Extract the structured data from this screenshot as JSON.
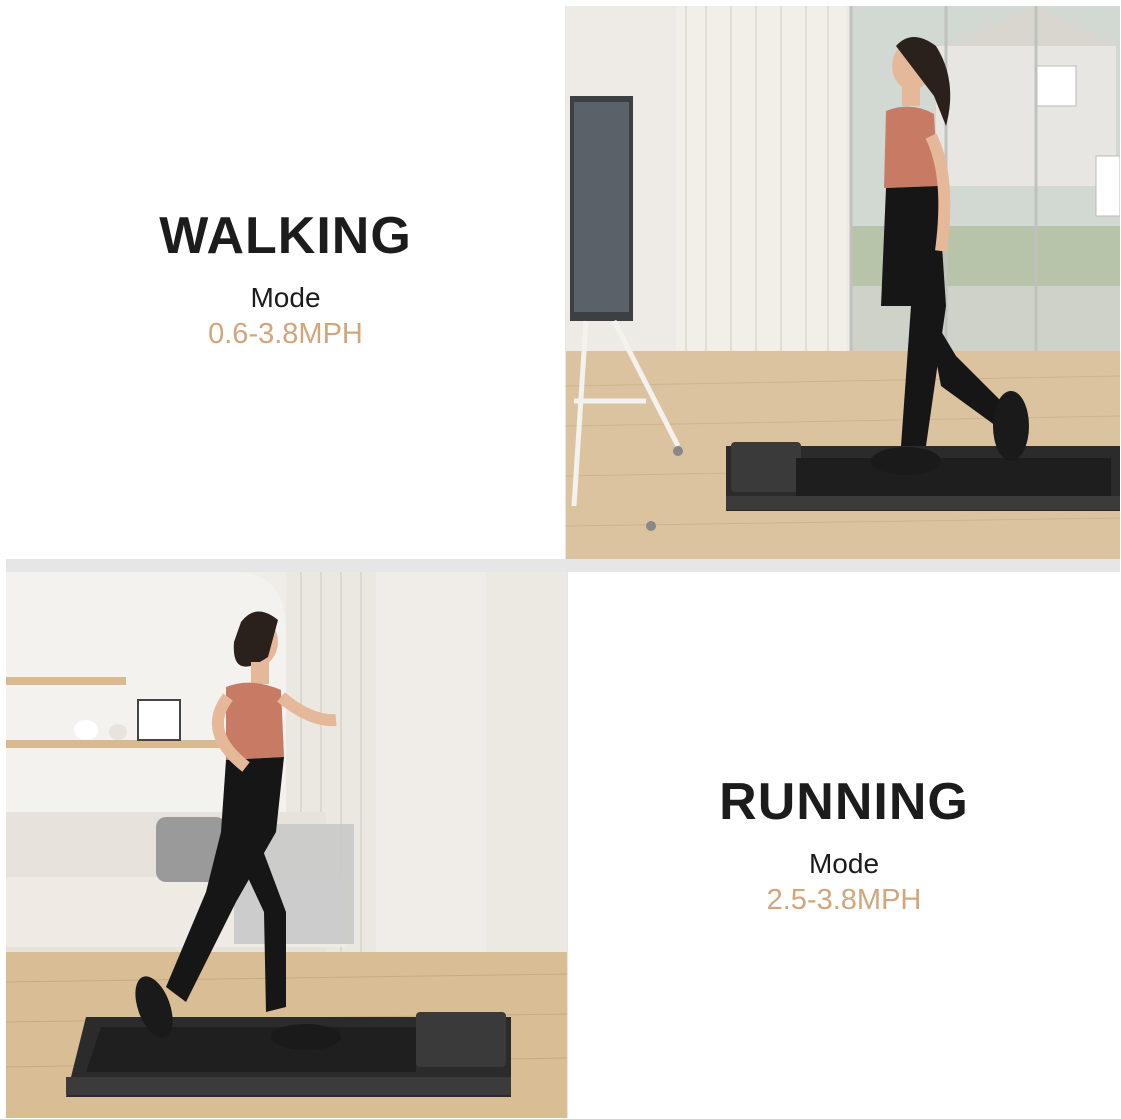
{
  "panels": {
    "walking": {
      "title": "WALKING",
      "subtitle": "Mode",
      "speed": "0.6-3.8MPH"
    },
    "running": {
      "title": "RUNNING",
      "subtitle": "Mode",
      "speed": "2.5-3.8MPH"
    }
  },
  "colors": {
    "title": "#1c1c1c",
    "speed_accent": "#d2a57b",
    "divider": "#e6e6e6",
    "treadmill": "#2b2b2b"
  },
  "photos": {
    "walking_photo": "woman-walking-on-treadmill",
    "running_photo": "woman-running-on-treadmill"
  }
}
